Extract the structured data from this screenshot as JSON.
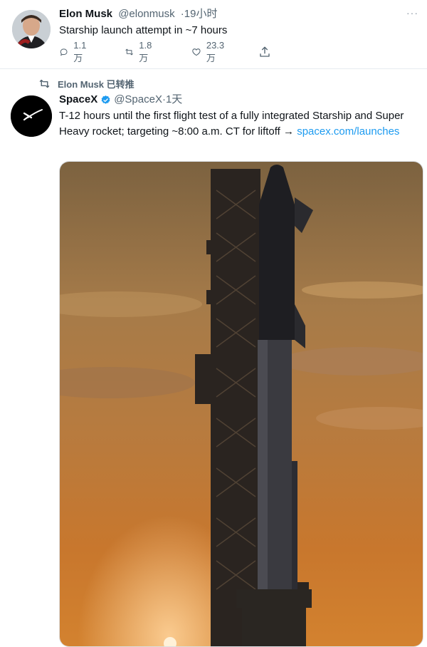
{
  "tweet": {
    "author_name": "Elon Musk",
    "author_handle": "@elonmusk",
    "time": "19小时",
    "text": "Starship launch attempt in ~7 hours",
    "more_label": "···",
    "actions": {
      "replies": "1.1万",
      "retweets": "1.8万",
      "likes": "23.3万"
    }
  },
  "retweet": {
    "retweeted_by": "Elon Musk 已转推",
    "author_name": "SpaceX",
    "author_handle": "@SpaceX",
    "time": "1天",
    "text_prefix": "T-12 hours until the first flight test of a fully integrated Starship and Super Heavy rocket; targeting ~8:00 a.m. CT for liftoff → ",
    "link_text": "spacex.com/launches"
  },
  "colors": {
    "accent_blue": "#1d9bf0",
    "muted_text": "#536471",
    "sky_top": "#8b6a3f",
    "sky_bottom": "#c8772d"
  }
}
